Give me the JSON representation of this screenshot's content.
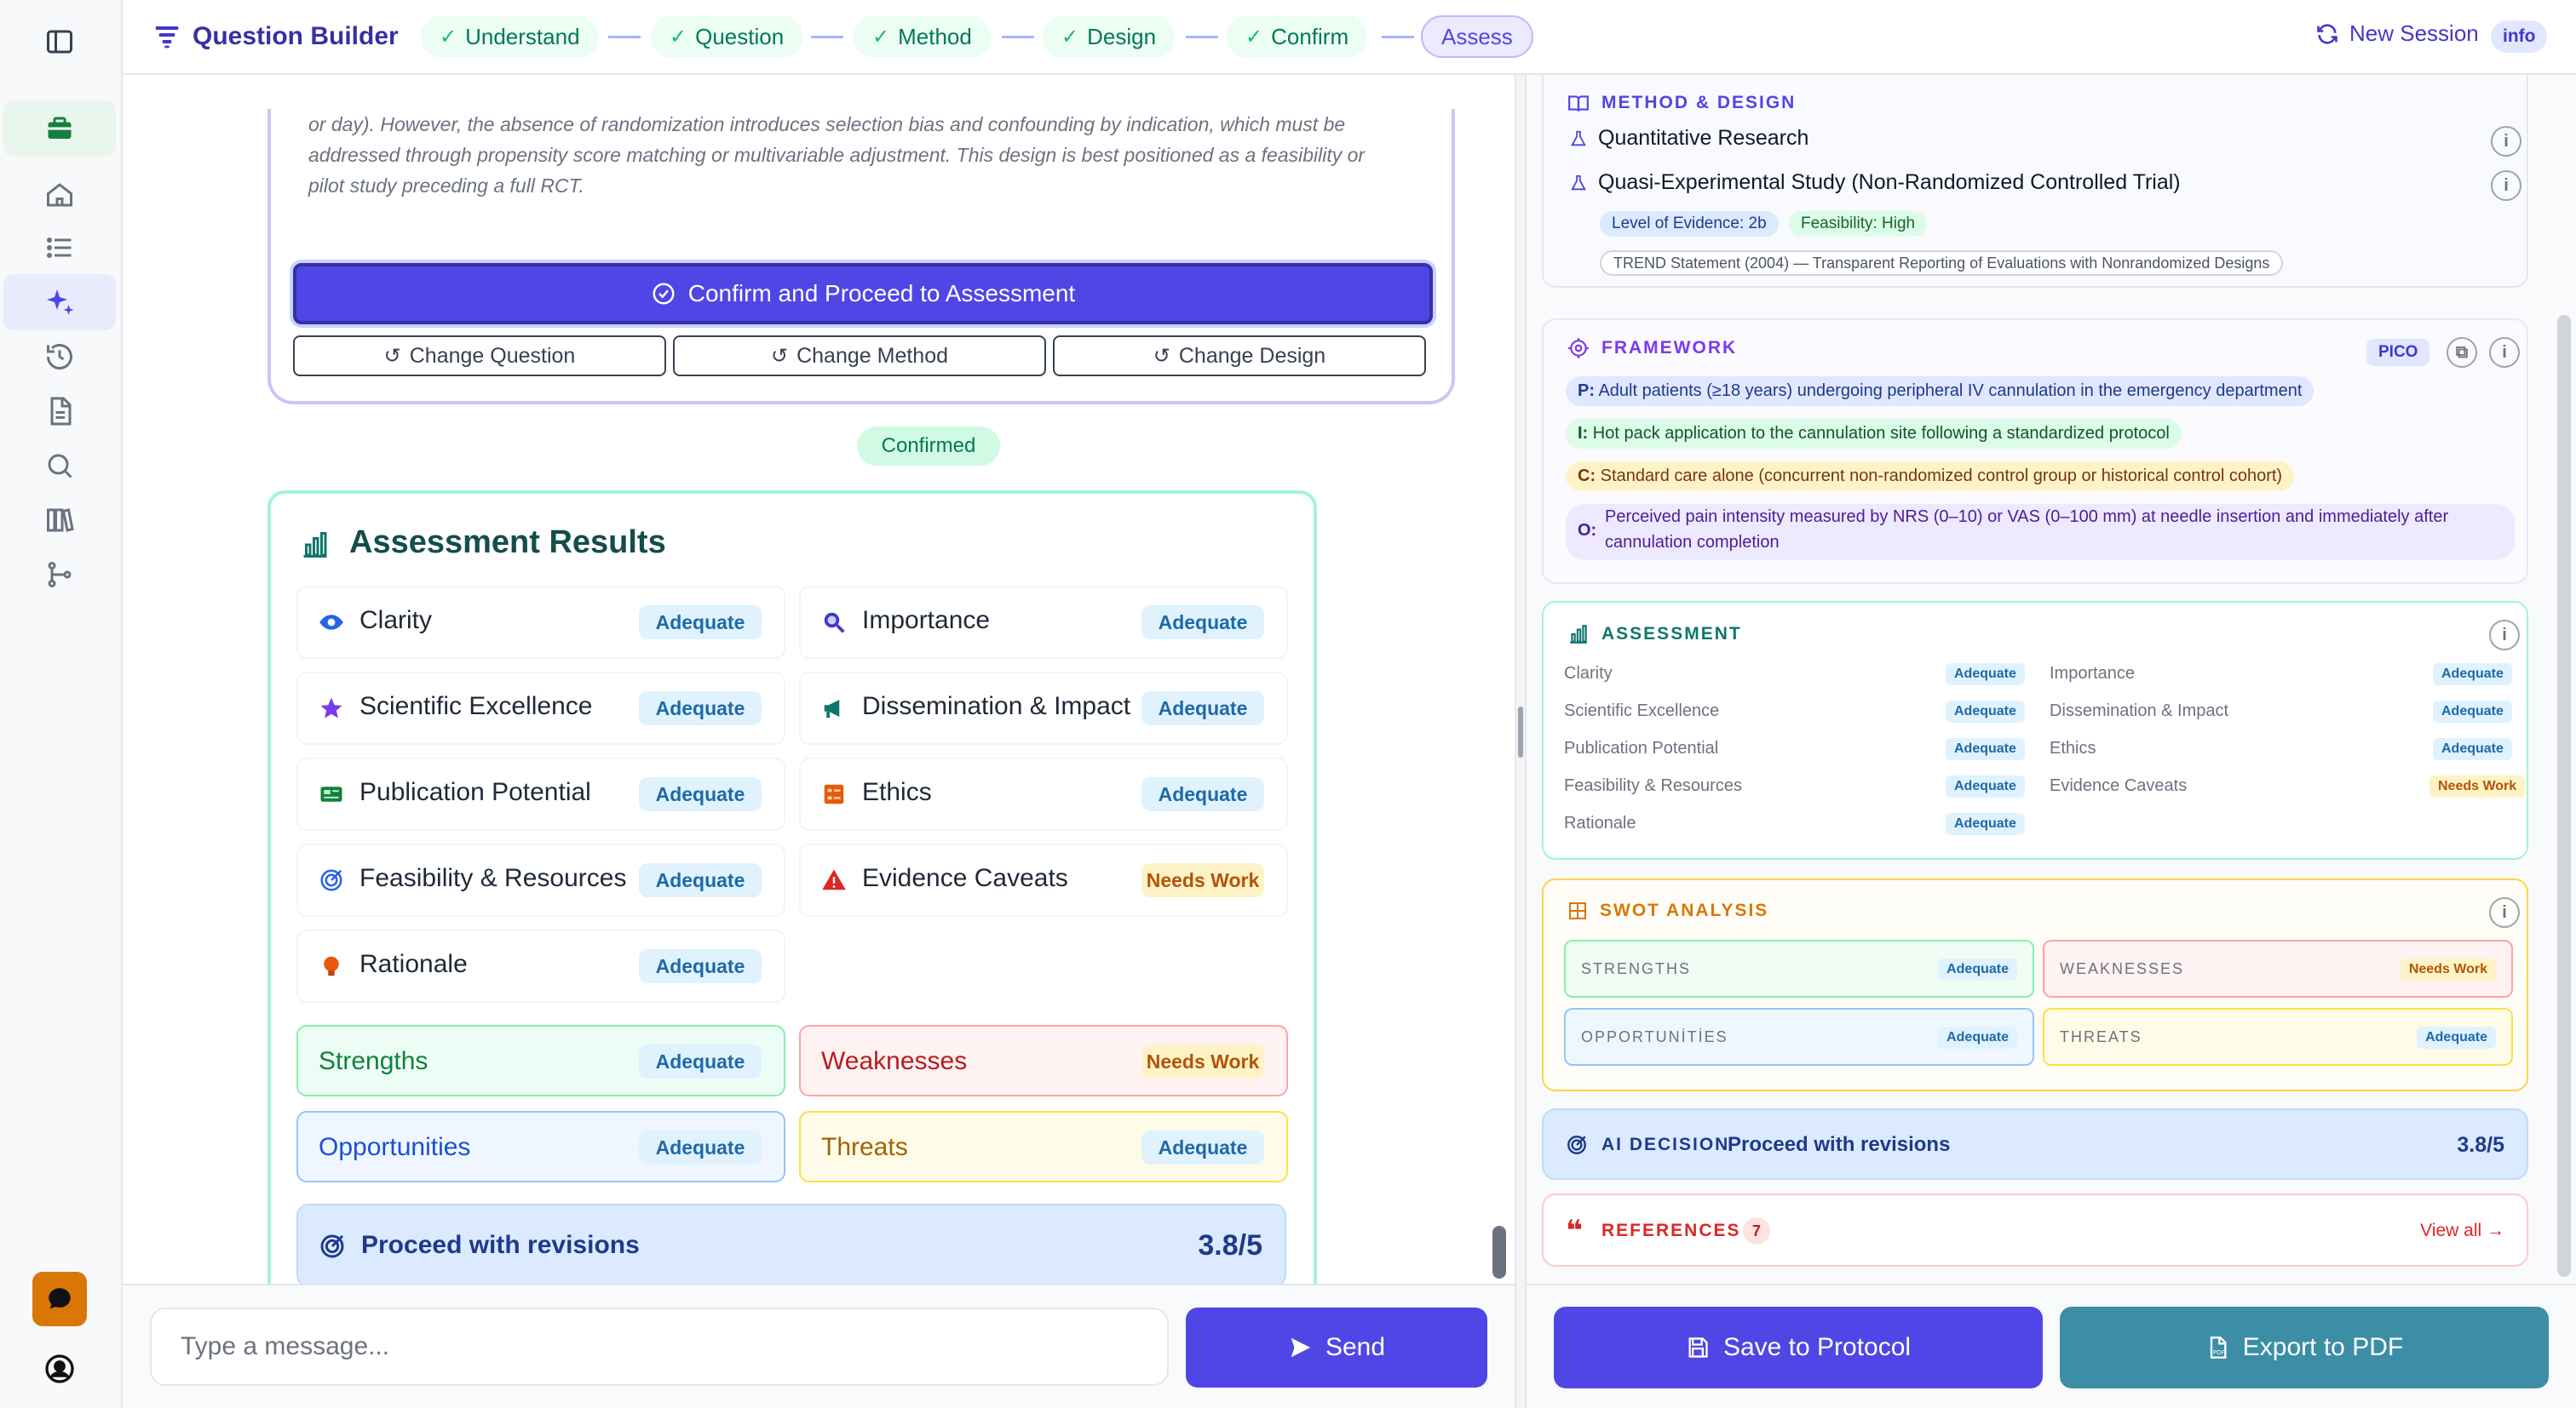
{
  "app": {
    "title": "Question Builder",
    "new_session": "New Session",
    "info_badge": "info"
  },
  "steps": [
    {
      "label": "Understand",
      "done": true
    },
    {
      "label": "Question",
      "done": true
    },
    {
      "label": "Method",
      "done": true
    },
    {
      "label": "Design",
      "done": true
    },
    {
      "label": "Confirm",
      "done": true
    },
    {
      "label": "Assess",
      "done": false
    }
  ],
  "sidebar": {
    "items": [
      "panel-toggle",
      "briefcase",
      "home",
      "list",
      "sparkle",
      "history",
      "document",
      "search",
      "library",
      "branch"
    ]
  },
  "confirm_card": {
    "lines": [
      "or day). However, the absence of randomization introduces selection bias and confounding by indication, which must be",
      "addressed through propensity score matching or multivariable adjustment. This design is best positioned as a feasibility or",
      "pilot study preceding a full RCT."
    ],
    "proceed_label": "Confirm and Proceed to Assessment",
    "change_question": "Change Question",
    "change_method": "Change Method",
    "change_design": "Change Design"
  },
  "confirmed_label": "Confirmed",
  "assessment": {
    "title": "Assessment Results",
    "items": [
      {
        "label": "Clarity",
        "status": "Adequate"
      },
      {
        "label": "Importance",
        "status": "Adequate"
      },
      {
        "label": "Scientific Excellence",
        "status": "Adequate"
      },
      {
        "label": "Dissemination & Impact",
        "status": "Adequate"
      },
      {
        "label": "Publication Potential",
        "status": "Adequate"
      },
      {
        "label": "Ethics",
        "status": "Adequate"
      },
      {
        "label": "Feasibility & Resources",
        "status": "Adequate"
      },
      {
        "label": "Evidence Caveats",
        "status": "Needs Work"
      },
      {
        "label": "Rationale",
        "status": "Adequate"
      }
    ],
    "swot": [
      {
        "label": "Strengths",
        "status": "Adequate"
      },
      {
        "label": "Weaknesses",
        "status": "Needs Work"
      },
      {
        "label": "Opportunities",
        "status": "Adequate"
      },
      {
        "label": "Threats",
        "status": "Adequate"
      }
    ],
    "decision": {
      "label": "Proceed with revisions",
      "score": "3.8/5"
    }
  },
  "composer": {
    "placeholder": "Type a message...",
    "send_label": "Send"
  },
  "right": {
    "method_design": {
      "heading": "METHOD & DESIGN",
      "method": "Quantitative Research",
      "design": "Quasi-Experimental Study (Non-Randomized Controlled Trial)",
      "evidence_level": "Level of Evidence: 2b",
      "feasibility": "Feasibility: High",
      "reporting": "TREND Statement (2004) — Transparent Reporting of Evaluations with Nonrandomized Designs"
    },
    "framework": {
      "heading": "FRAMEWORK",
      "type": "PICO",
      "p": {
        "key": "P:",
        "text": "Adult patients (≥18 years) undergoing peripheral IV cannulation in the emergency department"
      },
      "i": {
        "key": "I:",
        "text": "Hot pack application to the cannulation site following a standardized protocol"
      },
      "c": {
        "key": "C:",
        "text": "Standard care alone (concurrent non-randomized control group or historical control cohort)"
      },
      "o": {
        "key": "O:",
        "line1": "Perceived pain intensity measured by NRS (0–10) or VAS (0–100 mm) at needle insertion and immediately after",
        "line2": "cannulation completion"
      }
    },
    "assessment": {
      "heading": "ASSESSMENT",
      "left": [
        {
          "label": "Clarity",
          "status": "Adequate"
        },
        {
          "label": "Scientific Excellence",
          "status": "Adequate"
        },
        {
          "label": "Publication Potential",
          "status": "Adequate"
        },
        {
          "label": "Feasibility & Resources",
          "status": "Adequate"
        },
        {
          "label": "Rationale",
          "status": "Adequate"
        }
      ],
      "right": [
        {
          "label": "Importance",
          "status": "Adequate"
        },
        {
          "label": "Dissemination & Impact",
          "status": "Adequate"
        },
        {
          "label": "Ethics",
          "status": "Adequate"
        },
        {
          "label": "Evidence Caveats",
          "status": "Needs Work"
        }
      ]
    },
    "swot": {
      "heading": "SWOT ANALYSIS",
      "items": [
        {
          "label": "STRENGTHS",
          "status": "Adequate"
        },
        {
          "label": "WEAKNESSES",
          "status": "Needs Work"
        },
        {
          "label": "OPPORTUNİTİES",
          "status": "Adequate"
        },
        {
          "label": "THREATS",
          "status": "Adequate"
        }
      ]
    },
    "ai_decision": {
      "heading": "AI DECISION",
      "label": "Proceed with revisions",
      "score": "3.8/5"
    },
    "references": {
      "heading": "REFERENCES",
      "count": "7",
      "view_all": "View all →"
    },
    "save_label": "Save to Protocol",
    "export_label": "Export to PDF"
  },
  "colors": {
    "accent": "#4f46e5",
    "teal": "#3b8ea5",
    "success": "#10b981",
    "warning": "#b45309"
  }
}
